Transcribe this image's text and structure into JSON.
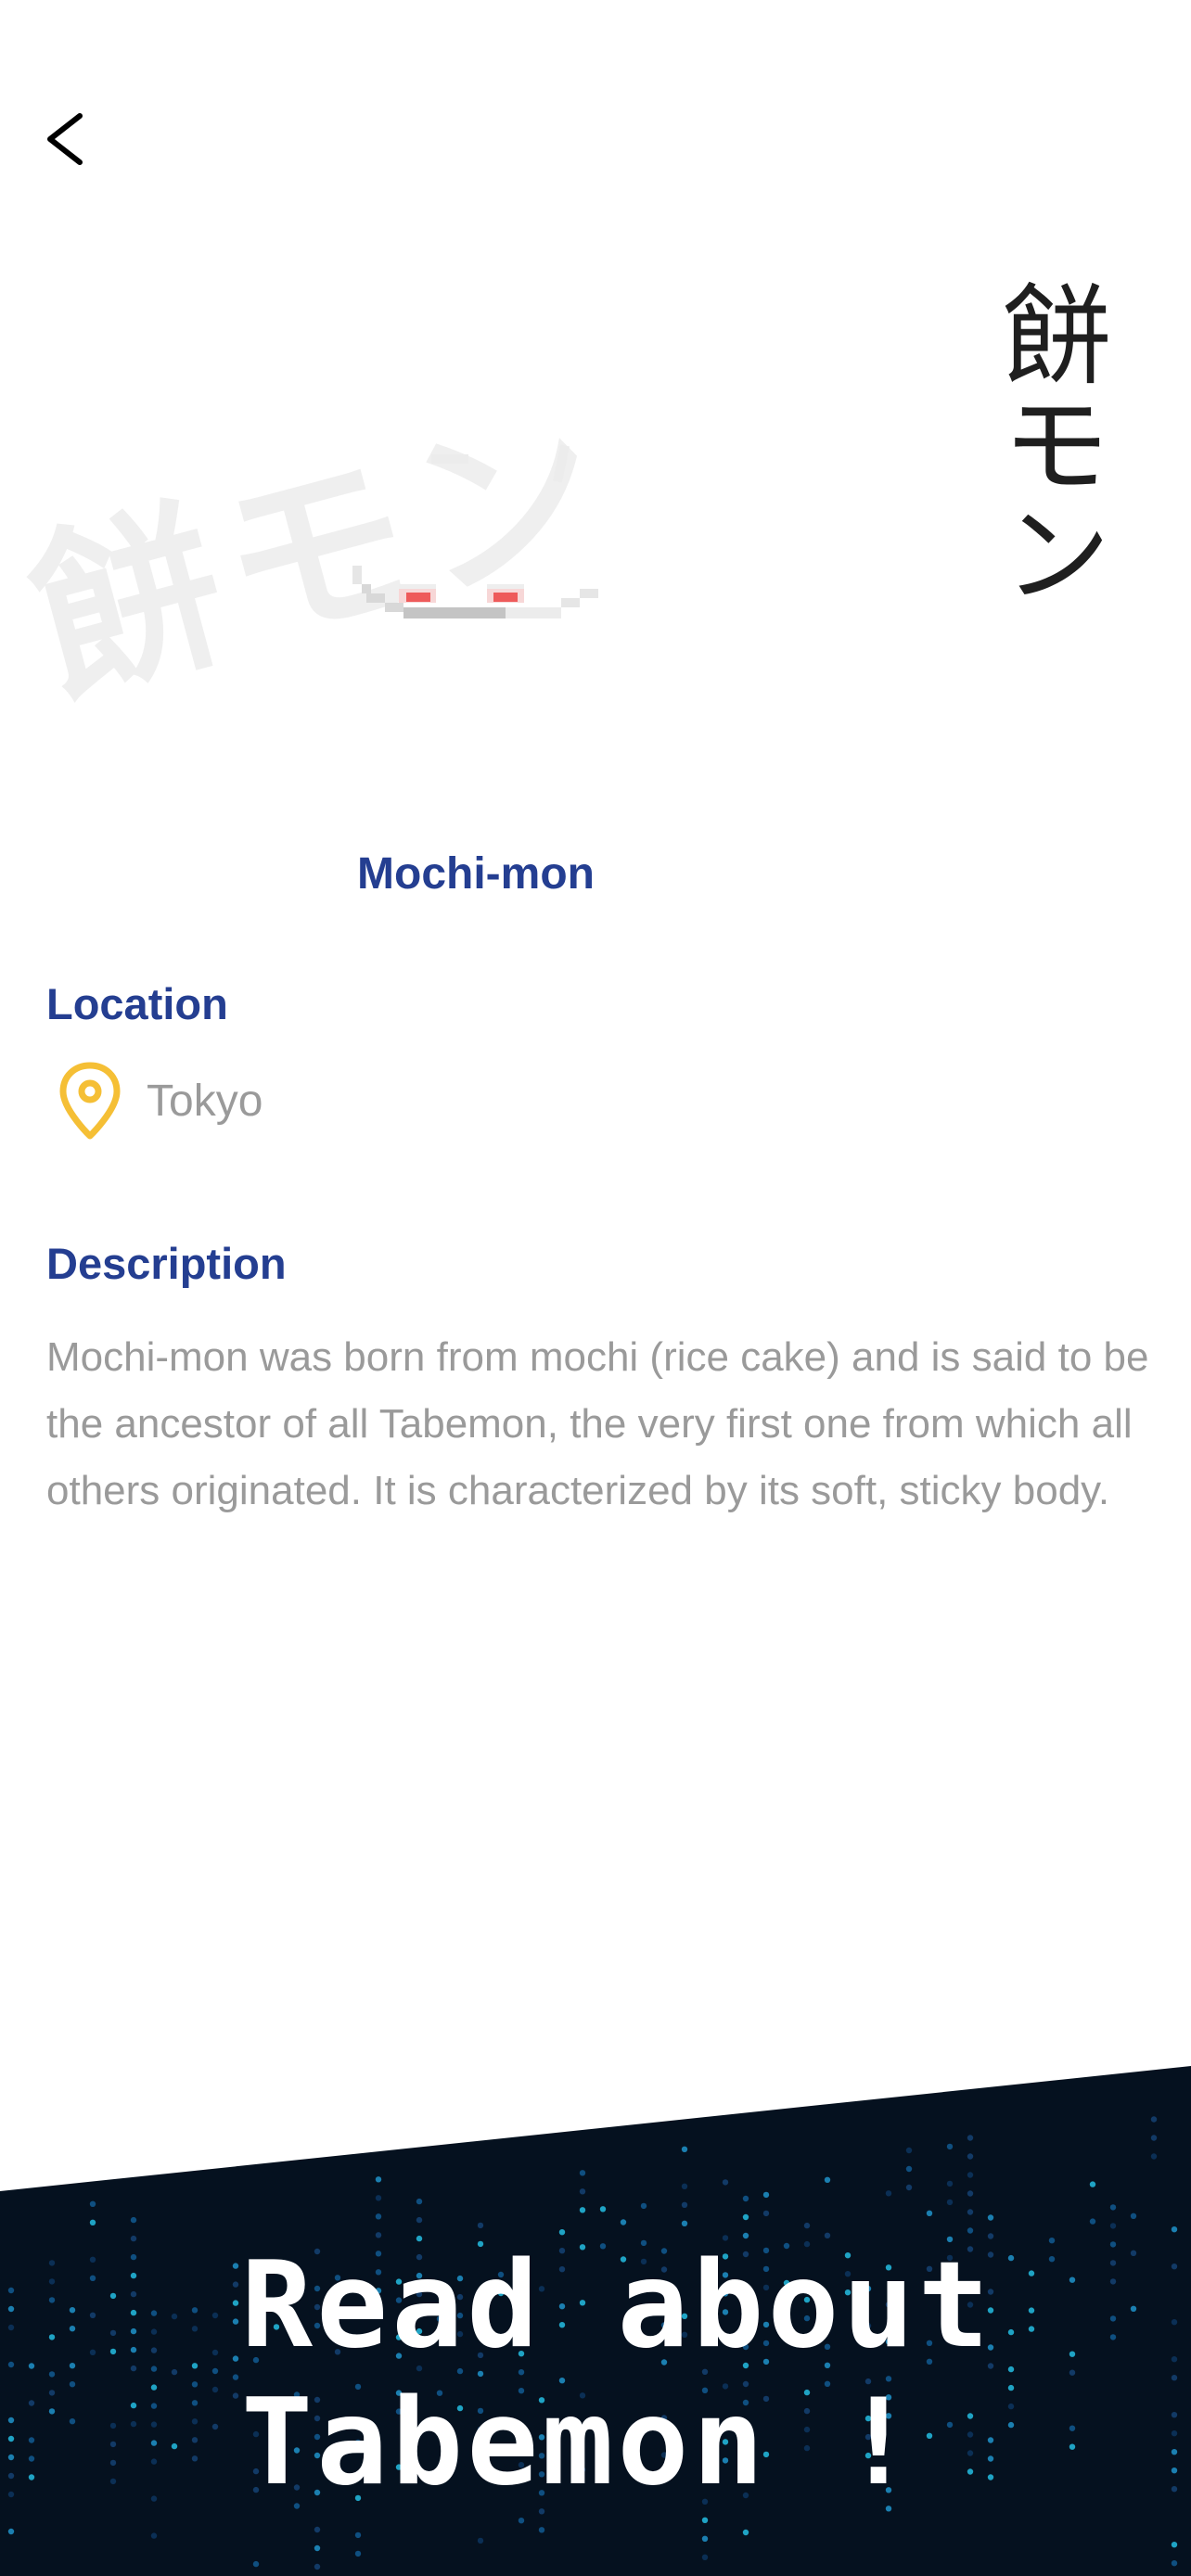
{
  "vertical_title": "餅モン",
  "watermark_text": "餅モン",
  "monster": {
    "name": "Mochi-mon"
  },
  "location": {
    "heading": "Location",
    "value": "Tokyo",
    "pin_color": "#f5bf35"
  },
  "description": {
    "heading": "Description",
    "text": "Mochi-mon was born from mochi (rice cake) and is said to be the ancestor of all Tabemon, the very first one from which all others originated. It is characterized by its soft, sticky body."
  },
  "banner": {
    "line1": "Read about",
    "line2": "Tabemon !",
    "background": "#05111f"
  },
  "colors": {
    "accent": "#243e91",
    "muted_text": "#9a9a9a"
  },
  "icons": [
    "chevron-left-icon",
    "location-pin-icon"
  ]
}
